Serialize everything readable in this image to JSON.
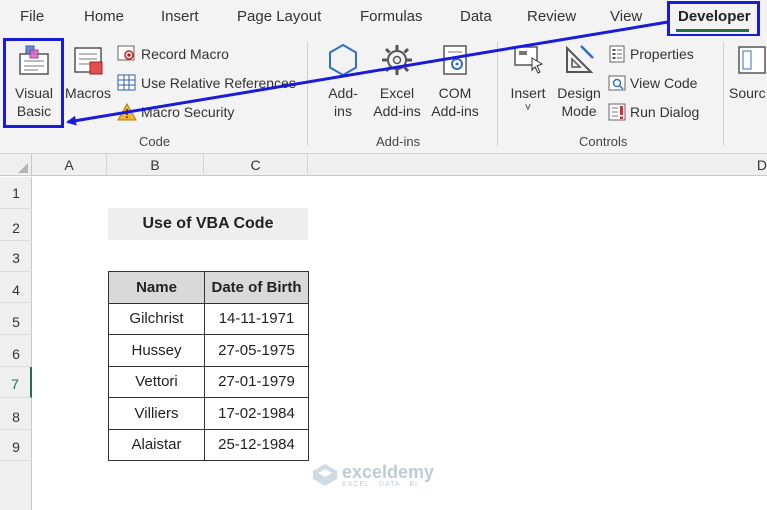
{
  "tabs": [
    {
      "label": "File"
    },
    {
      "label": "Home"
    },
    {
      "label": "Insert"
    },
    {
      "label": "Page Layout"
    },
    {
      "label": "Formulas"
    },
    {
      "label": "Data"
    },
    {
      "label": "Review"
    },
    {
      "label": "View"
    },
    {
      "label": "Developer"
    }
  ],
  "ribbon": {
    "code": {
      "label": "Code",
      "visual_basic": "Visual\nBasic",
      "macros": "Macros",
      "record_macro": "Record Macro",
      "use_relative": "Use Relative References",
      "macro_security": "Macro Security"
    },
    "addins": {
      "label": "Add-ins",
      "addins": "Add-\nins",
      "excel_addins": "Excel\nAdd-ins",
      "com_addins": "COM\nAdd-ins"
    },
    "controls": {
      "label": "Controls",
      "insert": "Insert",
      "insert_caret": "˅",
      "design_mode": "Design\nMode",
      "properties": "Properties",
      "view_code": "View Code",
      "run_dialog": "Run Dialog"
    },
    "source": "Sourc"
  },
  "columns": [
    "A",
    "B",
    "C",
    "D"
  ],
  "rows": [
    "1",
    "2",
    "3",
    "4",
    "5",
    "6",
    "7",
    "8",
    "9"
  ],
  "sheet": {
    "title": "Use of VBA Code",
    "headers": [
      "Name",
      "Date of Birth"
    ],
    "records": [
      [
        "Gilchrist",
        "14-11-1971"
      ],
      [
        "Hussey",
        "27-05-1975"
      ],
      [
        "Vettori",
        "27-01-1979"
      ],
      [
        "Villiers",
        "17-02-1984"
      ],
      [
        "Alaistar",
        "25-12-1984"
      ]
    ]
  },
  "watermark": {
    "name": "exceldemy",
    "tagline": "EXCEL · DATA · BI"
  },
  "colors": {
    "accent": "#217346",
    "highlight": "#1a1adb"
  }
}
